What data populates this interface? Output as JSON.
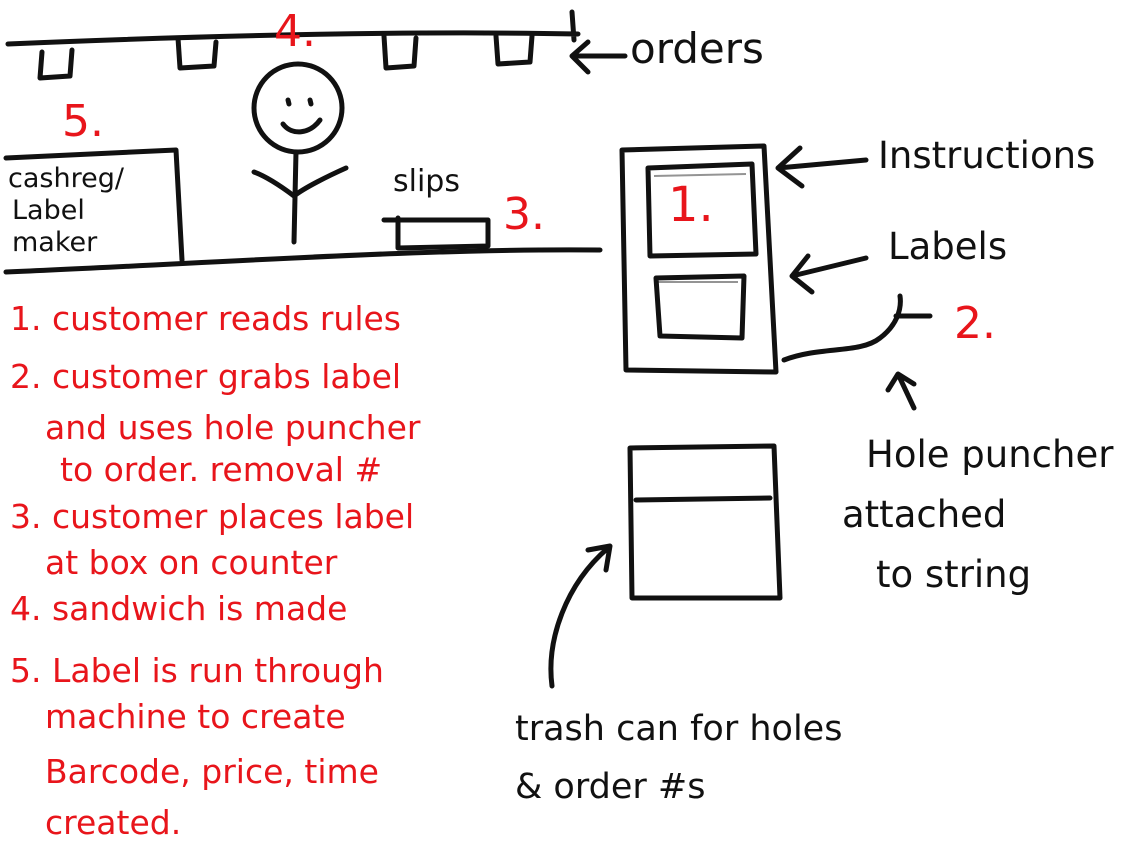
{
  "top": {
    "orders_label": "orders",
    "step_marker": "4."
  },
  "register": {
    "step_marker": "5.",
    "line1": "cashreg/",
    "line2": "Label",
    "line3": "maker"
  },
  "slips": {
    "label": "slips",
    "step_marker": "3."
  },
  "board": {
    "step_marker": "1.",
    "instructions_label": "Instructions",
    "labels_label": "Labels",
    "side_marker": "2."
  },
  "hole_puncher": {
    "line1": "Hole puncher",
    "line2": "attached",
    "line3": "to string"
  },
  "trash": {
    "line1": "trash can for holes",
    "line2": "& order #s"
  },
  "steps": {
    "s1": "1. customer reads rules",
    "s2a": "2. customer grabs label",
    "s2b": "and uses hole puncher",
    "s2c": "to order. removal #",
    "s3a": "3. customer places label",
    "s3b": "at box on counter",
    "s4": "4. sandwich is made",
    "s5a": "5. Label is run through",
    "s5b": "machine to create",
    "s5c": "Barcode, price, time",
    "s5d": "created."
  },
  "colors": {
    "ink": "#111111",
    "accent_red": "#e8151b",
    "background": "#ffffff"
  }
}
